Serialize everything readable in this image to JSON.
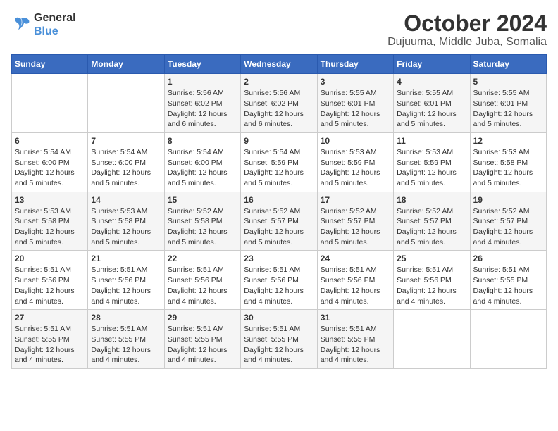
{
  "logo": {
    "line1": "General",
    "line2": "Blue"
  },
  "title": "October 2024",
  "subtitle": "Dujuuma, Middle Juba, Somalia",
  "days_of_week": [
    "Sunday",
    "Monday",
    "Tuesday",
    "Wednesday",
    "Thursday",
    "Friday",
    "Saturday"
  ],
  "weeks": [
    [
      {
        "day": "",
        "info": ""
      },
      {
        "day": "",
        "info": ""
      },
      {
        "day": "1",
        "info": "Sunrise: 5:56 AM\nSunset: 6:02 PM\nDaylight: 12 hours\nand 6 minutes."
      },
      {
        "day": "2",
        "info": "Sunrise: 5:56 AM\nSunset: 6:02 PM\nDaylight: 12 hours\nand 6 minutes."
      },
      {
        "day": "3",
        "info": "Sunrise: 5:55 AM\nSunset: 6:01 PM\nDaylight: 12 hours\nand 5 minutes."
      },
      {
        "day": "4",
        "info": "Sunrise: 5:55 AM\nSunset: 6:01 PM\nDaylight: 12 hours\nand 5 minutes."
      },
      {
        "day": "5",
        "info": "Sunrise: 5:55 AM\nSunset: 6:01 PM\nDaylight: 12 hours\nand 5 minutes."
      }
    ],
    [
      {
        "day": "6",
        "info": "Sunrise: 5:54 AM\nSunset: 6:00 PM\nDaylight: 12 hours\nand 5 minutes."
      },
      {
        "day": "7",
        "info": "Sunrise: 5:54 AM\nSunset: 6:00 PM\nDaylight: 12 hours\nand 5 minutes."
      },
      {
        "day": "8",
        "info": "Sunrise: 5:54 AM\nSunset: 6:00 PM\nDaylight: 12 hours\nand 5 minutes."
      },
      {
        "day": "9",
        "info": "Sunrise: 5:54 AM\nSunset: 5:59 PM\nDaylight: 12 hours\nand 5 minutes."
      },
      {
        "day": "10",
        "info": "Sunrise: 5:53 AM\nSunset: 5:59 PM\nDaylight: 12 hours\nand 5 minutes."
      },
      {
        "day": "11",
        "info": "Sunrise: 5:53 AM\nSunset: 5:59 PM\nDaylight: 12 hours\nand 5 minutes."
      },
      {
        "day": "12",
        "info": "Sunrise: 5:53 AM\nSunset: 5:58 PM\nDaylight: 12 hours\nand 5 minutes."
      }
    ],
    [
      {
        "day": "13",
        "info": "Sunrise: 5:53 AM\nSunset: 5:58 PM\nDaylight: 12 hours\nand 5 minutes."
      },
      {
        "day": "14",
        "info": "Sunrise: 5:53 AM\nSunset: 5:58 PM\nDaylight: 12 hours\nand 5 minutes."
      },
      {
        "day": "15",
        "info": "Sunrise: 5:52 AM\nSunset: 5:58 PM\nDaylight: 12 hours\nand 5 minutes."
      },
      {
        "day": "16",
        "info": "Sunrise: 5:52 AM\nSunset: 5:57 PM\nDaylight: 12 hours\nand 5 minutes."
      },
      {
        "day": "17",
        "info": "Sunrise: 5:52 AM\nSunset: 5:57 PM\nDaylight: 12 hours\nand 5 minutes."
      },
      {
        "day": "18",
        "info": "Sunrise: 5:52 AM\nSunset: 5:57 PM\nDaylight: 12 hours\nand 5 minutes."
      },
      {
        "day": "19",
        "info": "Sunrise: 5:52 AM\nSunset: 5:57 PM\nDaylight: 12 hours\nand 4 minutes."
      }
    ],
    [
      {
        "day": "20",
        "info": "Sunrise: 5:51 AM\nSunset: 5:56 PM\nDaylight: 12 hours\nand 4 minutes."
      },
      {
        "day": "21",
        "info": "Sunrise: 5:51 AM\nSunset: 5:56 PM\nDaylight: 12 hours\nand 4 minutes."
      },
      {
        "day": "22",
        "info": "Sunrise: 5:51 AM\nSunset: 5:56 PM\nDaylight: 12 hours\nand 4 minutes."
      },
      {
        "day": "23",
        "info": "Sunrise: 5:51 AM\nSunset: 5:56 PM\nDaylight: 12 hours\nand 4 minutes."
      },
      {
        "day": "24",
        "info": "Sunrise: 5:51 AM\nSunset: 5:56 PM\nDaylight: 12 hours\nand 4 minutes."
      },
      {
        "day": "25",
        "info": "Sunrise: 5:51 AM\nSunset: 5:56 PM\nDaylight: 12 hours\nand 4 minutes."
      },
      {
        "day": "26",
        "info": "Sunrise: 5:51 AM\nSunset: 5:55 PM\nDaylight: 12 hours\nand 4 minutes."
      }
    ],
    [
      {
        "day": "27",
        "info": "Sunrise: 5:51 AM\nSunset: 5:55 PM\nDaylight: 12 hours\nand 4 minutes."
      },
      {
        "day": "28",
        "info": "Sunrise: 5:51 AM\nSunset: 5:55 PM\nDaylight: 12 hours\nand 4 minutes."
      },
      {
        "day": "29",
        "info": "Sunrise: 5:51 AM\nSunset: 5:55 PM\nDaylight: 12 hours\nand 4 minutes."
      },
      {
        "day": "30",
        "info": "Sunrise: 5:51 AM\nSunset: 5:55 PM\nDaylight: 12 hours\nand 4 minutes."
      },
      {
        "day": "31",
        "info": "Sunrise: 5:51 AM\nSunset: 5:55 PM\nDaylight: 12 hours\nand 4 minutes."
      },
      {
        "day": "",
        "info": ""
      },
      {
        "day": "",
        "info": ""
      }
    ]
  ]
}
